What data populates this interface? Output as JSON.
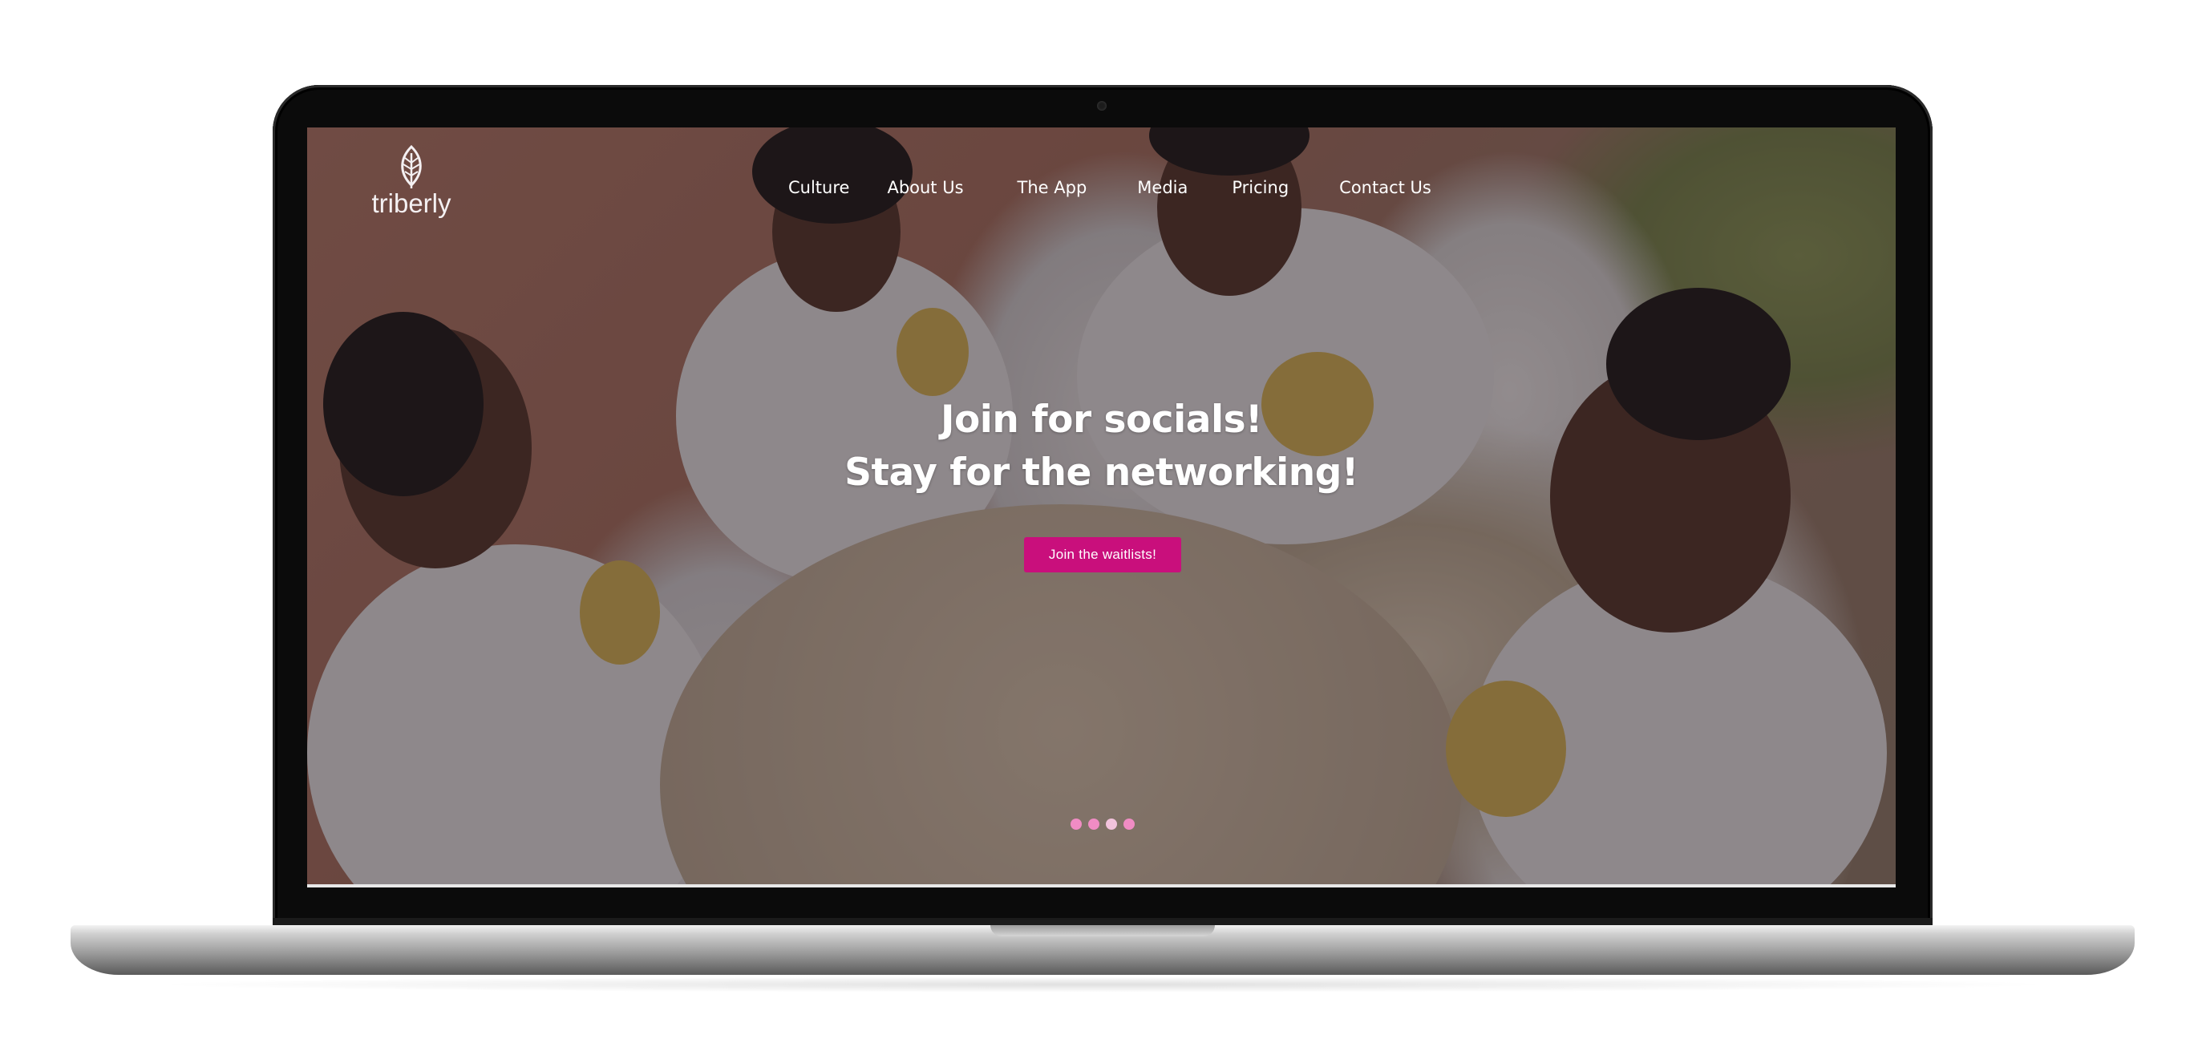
{
  "site": {
    "logo_text": "triberly",
    "logo_icon": "feather-icon"
  },
  "nav": {
    "items": [
      {
        "label": "Culture"
      },
      {
        "label": "About Us"
      },
      {
        "label": "The App"
      },
      {
        "label": "Media"
      },
      {
        "label": "Pricing"
      },
      {
        "label": "Contact Us"
      }
    ]
  },
  "hero": {
    "line1": "Join for socials!",
    "line2": "Stay for the networking!",
    "cta_label": "Join the waitlists!"
  },
  "carousel": {
    "slide_count": 4
  },
  "colors": {
    "accent": "#c90f7c",
    "dot": "#f08cc4"
  }
}
